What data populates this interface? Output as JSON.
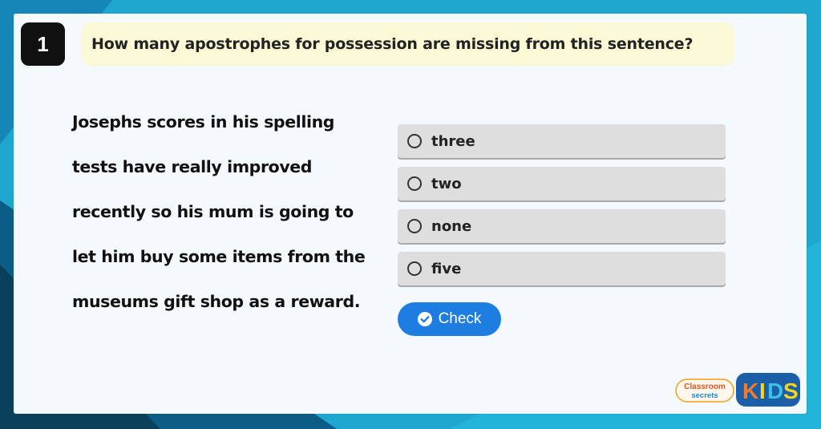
{
  "question": {
    "number": "1",
    "text": "How many apostrophes for possession are missing from this sentence?"
  },
  "passage": {
    "lines": [
      "Josephs scores in his spelling",
      "tests have really improved",
      "recently so his mum is going to",
      "let him buy some items from the",
      "museums gift shop as a reward."
    ]
  },
  "options": [
    {
      "label": "three",
      "selected": false
    },
    {
      "label": "two",
      "selected": false
    },
    {
      "label": "none",
      "selected": false
    },
    {
      "label": "five",
      "selected": false
    }
  ],
  "check_button": {
    "label": "Check"
  },
  "branding": {
    "classroom_line1": "Classroom",
    "classroom_line2": "secrets",
    "kids": "KIDS"
  },
  "colors": {
    "background": "#1b9fc9",
    "card": "#f3f9fc",
    "question_bg": "#fbf8d5",
    "option_bg": "#dedede",
    "check_button": "#1d7de0",
    "kids_badge": "#1a5fa8"
  },
  "icons": {
    "check_button_icon": "check-circle-icon",
    "option_icon": "radio-icon"
  }
}
